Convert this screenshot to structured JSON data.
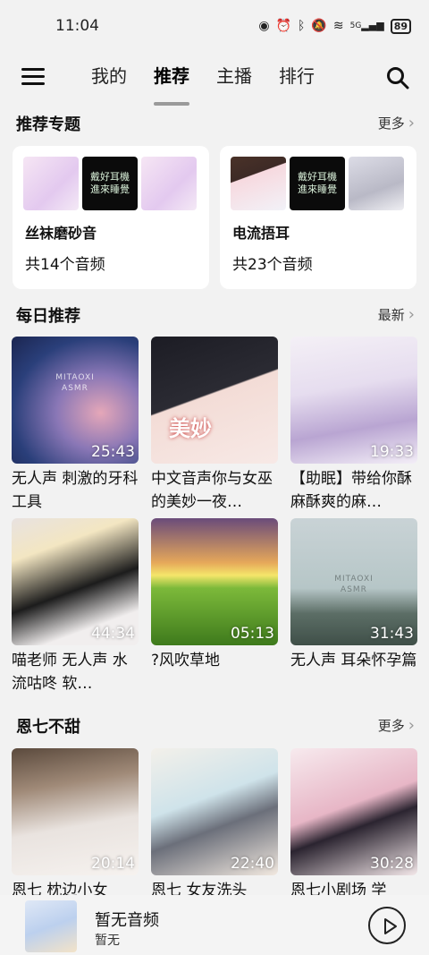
{
  "status_bar": {
    "time": "11:04",
    "battery": "89",
    "signal_label": "5G"
  },
  "nav": {
    "tabs": [
      {
        "label": "我的",
        "active": false
      },
      {
        "label": "推荐",
        "active": true
      },
      {
        "label": "主播",
        "active": false
      },
      {
        "label": "排行",
        "active": false
      }
    ],
    "menu_icon": "hamburger-icon",
    "search_icon": "search-icon"
  },
  "recommended_topics": {
    "title": "推荐专题",
    "more": "更多",
    "cards": [
      {
        "name": "丝袜磨砂音",
        "count": "共14个音频",
        "thumb_text": "戴好耳機\n進來睡覺"
      },
      {
        "name": "电流捂耳",
        "count": "共23个音频",
        "thumb_text": "戴好耳機\n進來睡覺"
      }
    ]
  },
  "daily": {
    "title": "每日推荐",
    "more": "最新",
    "items": [
      {
        "title": "无人声 刺激的牙科工具",
        "duration": "25:43",
        "mark": "MITAOXI\nASMR"
      },
      {
        "title": "中文音声你与女巫的美妙一夜…",
        "duration": "",
        "overlay": "美妙"
      },
      {
        "title": "【助眠】带给你酥麻酥爽的麻…",
        "duration": "19:33"
      },
      {
        "title": "喵老师 无人声 水流咕咚 软…",
        "duration": "44:34"
      },
      {
        "title": "?风吹草地",
        "duration": "05:13"
      },
      {
        "title": "无人声 耳朵怀孕篇",
        "duration": "31:43",
        "mark": "MITAOXI\nASMR"
      }
    ]
  },
  "enqi": {
    "title": "恩七不甜",
    "more": "更多",
    "items": [
      {
        "title": "恩七 枕边小女",
        "duration": "20:14"
      },
      {
        "title": "恩七 女友洗头",
        "duration": "22:40"
      },
      {
        "title": "恩七小剧场 学",
        "duration": "30:28"
      }
    ]
  },
  "player": {
    "title": "暂无音频",
    "subtitle": "暂无",
    "play_icon": "play-icon"
  }
}
